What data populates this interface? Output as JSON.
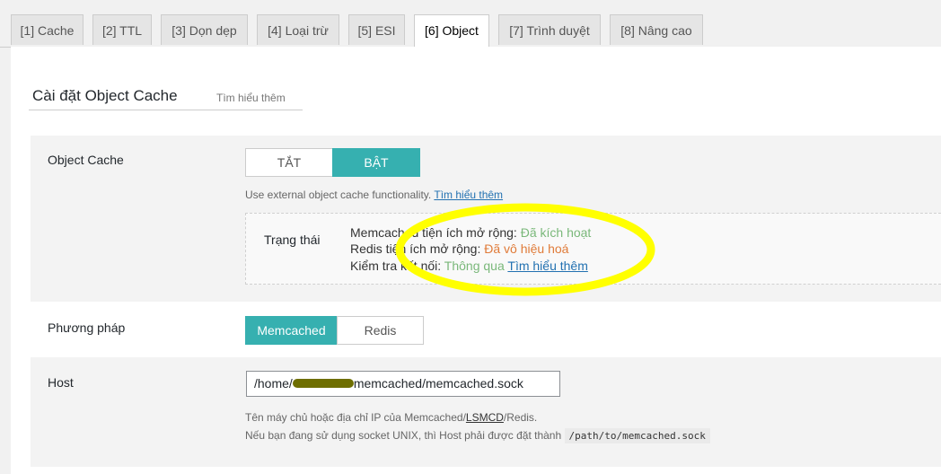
{
  "tabs": [
    {
      "label": "[1] Cache"
    },
    {
      "label": "[2] TTL"
    },
    {
      "label": "[3] Dọn dẹp"
    },
    {
      "label": "[4] Loại trừ"
    },
    {
      "label": "[5] ESI"
    },
    {
      "label": "[6] Object"
    },
    {
      "label": "[7] Trình duyệt"
    },
    {
      "label": "[8] Nâng cao"
    }
  ],
  "header": {
    "title": "Cài đặt Object Cache",
    "learn_more": "Tìm hiểu thêm"
  },
  "object_cache": {
    "label": "Object Cache",
    "off_label": "TẮT",
    "on_label": "BẬT",
    "desc": "Use external object cache functionality.",
    "desc_link": "Tìm hiểu thêm"
  },
  "status": {
    "label": "Trạng thái",
    "memcached_prefix": "Memcached tiện ích mở rộng: ",
    "memcached_value": "Đã kích hoạt",
    "redis_prefix": "Redis tiện ích mở rộng: ",
    "redis_value": "Đã vô hiệu hoá",
    "conn_prefix": "Kiểm tra kết nối: ",
    "conn_value": "Thông qua",
    "conn_link": "Tìm hiểu thêm"
  },
  "method": {
    "label": "Phương pháp",
    "memcached_label": "Memcached",
    "redis_label": "Redis"
  },
  "host": {
    "label": "Host",
    "value_prefix": "/home/",
    "value_suffix": "memcached/memcached.sock",
    "desc1_prefix": "Tên máy chủ hoặc địa chỉ IP của Memcached/",
    "desc1_link": "LSMCD",
    "desc1_suffix": "/Redis.",
    "desc2": "Nếu bạn đang sử dụng socket UNIX, thì Host phải được đặt thành",
    "desc2_code": "/path/to/memcached.sock"
  },
  "colors": {
    "accent": "#36b0b0",
    "highlight": "#ffff00",
    "ok": "#7ab87a",
    "warn": "#e07b39"
  }
}
